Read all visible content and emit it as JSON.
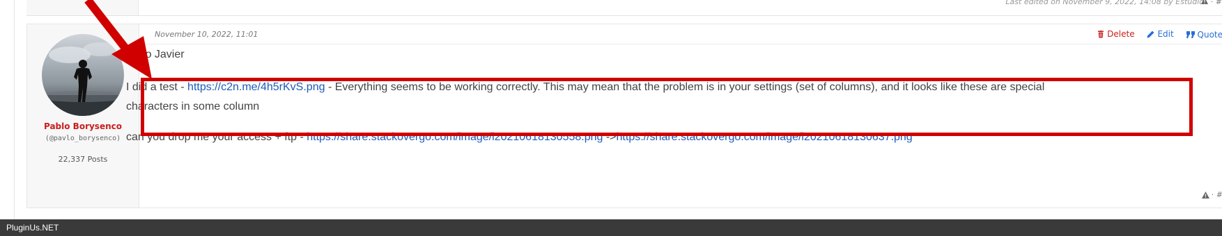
{
  "previous_post": {
    "edit_note": "Last edited on November 9, 2022, 14:08 by Estudio",
    "tools": "· #"
  },
  "post": {
    "date": "November 10, 2022, 11:01",
    "author": {
      "name": "Pablo Borysenco",
      "handle": "(@pavlo_borysenco)",
      "posts": "22,337 Posts"
    },
    "actions": {
      "delete": "Delete",
      "edit": "Edit",
      "quote": "Quote"
    },
    "greeting": "Hello Javier",
    "test_paragraph": {
      "before": "I did  a test - ",
      "link": "https://c2n.me/4h5rKvS.png",
      "after": "  - Everything seems to be working correctly. This may mean that the problem is in your settings (set of columns), and it looks like these are special characters in some column"
    },
    "ask_paragraph": {
      "before": "can you  drop  me  your  access + ftp  - ",
      "link1": "https://share.stackovergo.com/image/i20210618130558.png",
      "middle": " ->",
      "link2": "https://share.stackovergo.com/image/i20210618130637.png"
    },
    "footer_tools": "· #"
  },
  "footer": {
    "brand": "PluginUs.NET"
  },
  "colors": {
    "annotation_red": "#d10000",
    "author_red": "#c81e1e",
    "link_blue": "#1d5bb8",
    "footer_bg": "#3a3a3a"
  }
}
